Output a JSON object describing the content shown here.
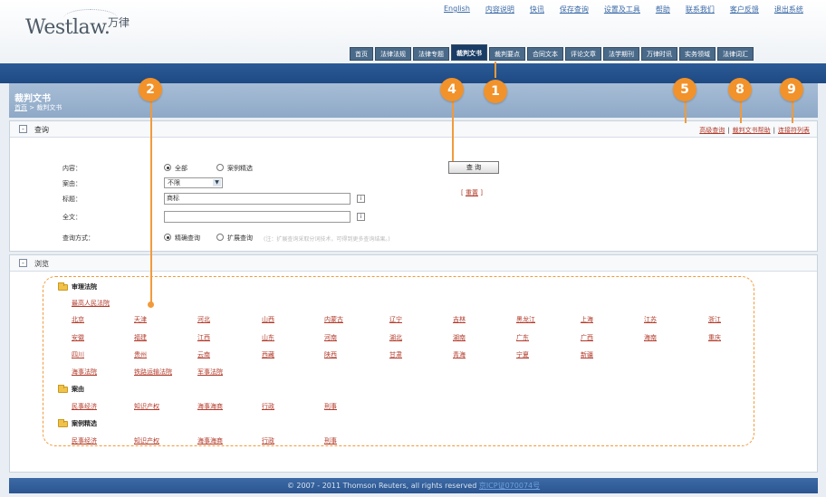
{
  "brand": {
    "logo": "Westlaw.",
    "logo_cn": "万律"
  },
  "top_links": [
    "English",
    "内容说明",
    "快讯",
    "保存查询",
    "设置及工具",
    "帮助",
    "联系我们",
    "客户反馈",
    "退出系统"
  ],
  "nav_tabs": [
    {
      "label": "首页",
      "active": false
    },
    {
      "label": "法律法规",
      "active": false
    },
    {
      "label": "法律专题",
      "active": false
    },
    {
      "label": "裁判文书",
      "active": true
    },
    {
      "label": "裁判要点",
      "active": false
    },
    {
      "label": "合同文本",
      "active": false
    },
    {
      "label": "评论文章",
      "active": false
    },
    {
      "label": "法学期刊",
      "active": false
    },
    {
      "label": "万律时讯",
      "active": false
    },
    {
      "label": "实务领域",
      "active": false
    },
    {
      "label": "法律词汇",
      "active": false
    }
  ],
  "page": {
    "title": "裁判文书",
    "breadcrumb_home": "首页",
    "breadcrumb_sep": " > ",
    "breadcrumb_current": "裁判文书"
  },
  "query_panel": {
    "title": "查询",
    "links": [
      "高级查询",
      "裁判文书帮助",
      "连接符列表"
    ],
    "labels": {
      "content": "内容：",
      "cause": "案由：",
      "title": "标题：",
      "fulltext": "全文：",
      "mode": "查询方式："
    },
    "content_options": [
      "全部",
      "案例精选"
    ],
    "cause_value": "不限",
    "title_value": "商标",
    "fulltext_value": "",
    "info_icon": "i",
    "mode_options": [
      "精确查询",
      "扩展查询"
    ],
    "mode_hint": "(注：扩展查询采取分词技术，可得到更多查询结果。)",
    "query_button": "查 询",
    "reset": "重置"
  },
  "browse_panel": {
    "title": "浏览",
    "groups": {
      "court": "审理法院",
      "cause": "案由",
      "selected": "案例精选"
    },
    "supreme": "最高人民法院",
    "provinces_row1": [
      "北京",
      "天津",
      "河北",
      "山西",
      "内蒙古",
      "辽宁",
      "吉林",
      "黑龙江",
      "上海",
      "江苏",
      "浙江"
    ],
    "provinces_row2": [
      "安徽",
      "福建",
      "江西",
      "山东",
      "河南",
      "湖北",
      "湖南",
      "广东",
      "广西",
      "海南",
      "重庆"
    ],
    "provinces_row3": [
      "四川",
      "贵州",
      "云南",
      "西藏",
      "陕西",
      "甘肃",
      "青海",
      "宁夏",
      "新疆"
    ],
    "special_courts": [
      "海事法院",
      "铁路运输法院",
      "军事法院"
    ],
    "cause_items": [
      "民事经济",
      "知识产权",
      "海事海商",
      "行政",
      "刑事"
    ],
    "selected_items": [
      "民事经济",
      "知识产权",
      "海事海商",
      "行政",
      "刑事"
    ]
  },
  "badges": [
    "1",
    "2",
    "4",
    "5",
    "8",
    "9"
  ],
  "footer": {
    "text": "© 2007 - 2011 Thomson Reuters, all rights reserved",
    "icp": "京ICP证070074号"
  },
  "colors": {
    "accent_orange": "#f2922a",
    "link_red": "#b23a2a",
    "nav_blue": "#1e4a83"
  }
}
